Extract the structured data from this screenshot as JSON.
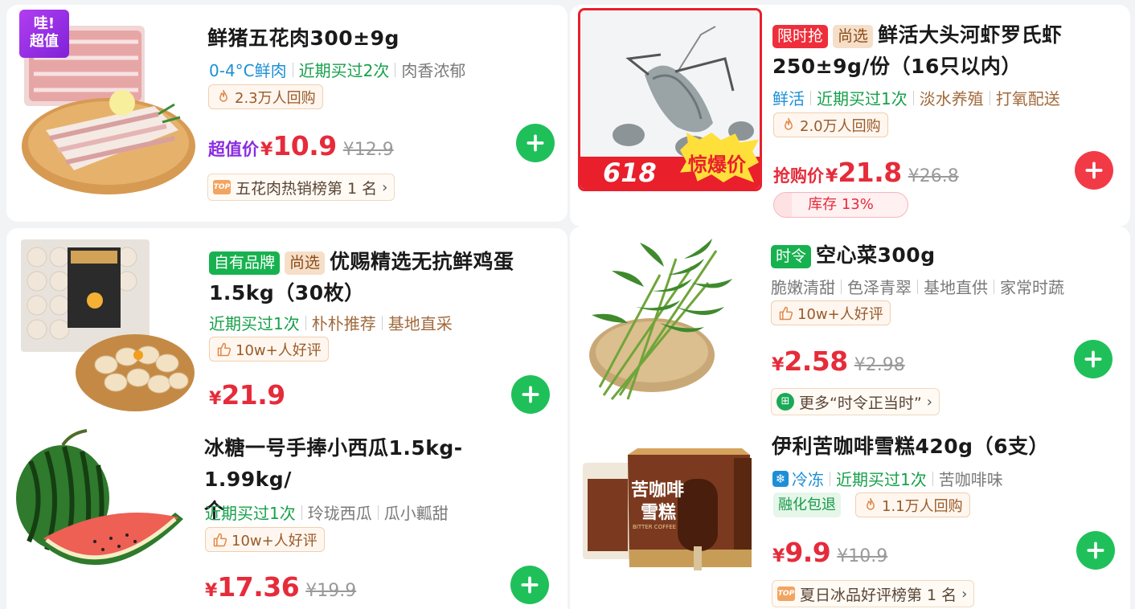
{
  "colors": {
    "accent_red": "#e62b3a",
    "add_green": "#1fc05a",
    "add_red": "#f23a47",
    "tag_green": "#16a04a",
    "tag_blue": "#1c8fd6"
  },
  "cards": [
    {
      "title": "鲜猪五花肉300±9g",
      "promo_badge": "哇!\n超值",
      "tags": [
        "0-4°C鲜肉",
        "近期买过2次",
        "肉香浓郁"
      ],
      "rebuy": "2.3万人回购",
      "price_label": "超值价",
      "currency": "¥",
      "price": "10.9",
      "original_price": "¥12.9",
      "rank_badge": "TOP",
      "rank_text": "五花肉热销榜第 1 名",
      "add_icon": "plus-icon"
    },
    {
      "badges": [
        "限时抢",
        "尚选"
      ],
      "title": "鲜活大头河虾罗氏虾250±9g/份（16只以内）",
      "title_line1": "鲜活大头河虾罗氏虾",
      "title_line2": "250±9g/份（16只以内）",
      "image_badge_618": "618",
      "image_badge_deal": "惊爆价",
      "tags": [
        "鲜活",
        "近期买过1次",
        "淡水养殖",
        "打氧配送"
      ],
      "rebuy": "2.0万人回购",
      "price_label": "抢购价",
      "currency": "¥",
      "price": "21.8",
      "original_price": "¥26.8",
      "stock_text": "库存 13%",
      "stock_percent": 13,
      "add_icon": "plus-icon"
    },
    {
      "badges": [
        "自有品牌",
        "尚选"
      ],
      "title_line1": "优赐精选无抗鲜鸡蛋",
      "title_line2": "1.5kg（30枚）",
      "tags": [
        "近期买过1次",
        "朴朴推荐",
        "基地直采"
      ],
      "reviews": "10w+人好评",
      "currency": "¥",
      "price": "21.9",
      "add_icon": "plus-icon"
    },
    {
      "badges": [
        "时令"
      ],
      "title": "空心菜300g",
      "tags": [
        "脆嫩清甜",
        "色泽青翠",
        "基地直供",
        "家常时蔬"
      ],
      "reviews": "10w+人好评",
      "currency": "¥",
      "price": "2.58",
      "original_price": "¥2.98",
      "more_link": "更多“时令正当时”",
      "add_icon": "plus-icon"
    },
    {
      "title_line1": "冰糖一号手捧小西瓜1.5kg-1.99kg/",
      "title_line2": "个",
      "tags": [
        "近期买过1次",
        "玲珑西瓜",
        "瓜小瓤甜"
      ],
      "reviews": "10w+人好评",
      "currency": "¥",
      "price": "17.36",
      "original_price": "¥19.9",
      "add_icon": "plus-icon"
    },
    {
      "title": "伊利苦咖啡雪糕420g（6支）",
      "tags": [
        "冷冻",
        "近期买过1次",
        "苦咖啡味"
      ],
      "badge_refund": "融化包退",
      "rebuy": "1.1万人回购",
      "currency": "¥",
      "price": "9.9",
      "original_price": "¥10.9",
      "rank_badge": "TOP",
      "rank_text": "夏日冰品好评榜第 1 名",
      "box_text_1": "苦咖啡",
      "box_text_2": "雪糕",
      "box_text_3": "BITTER COFFEE",
      "add_icon": "plus-icon"
    }
  ]
}
